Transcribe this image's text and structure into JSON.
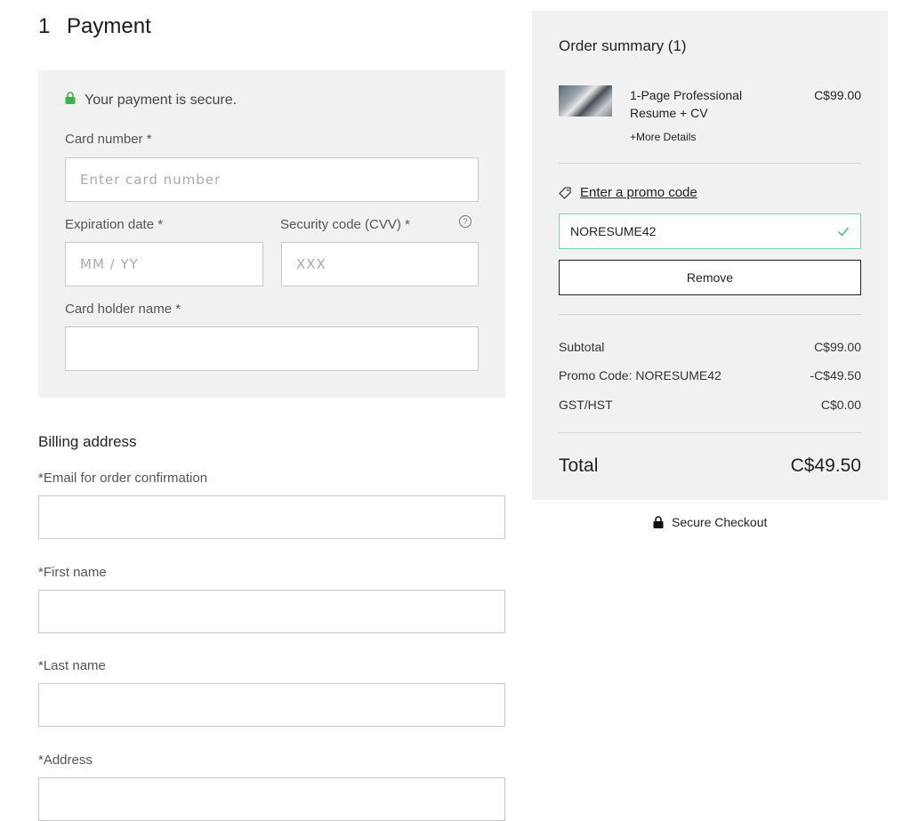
{
  "payment": {
    "step_number": "1",
    "title": "Payment",
    "secure_text": "Your payment is secure.",
    "card_number_label": "Card number *",
    "card_number_placeholder": "Enter card number",
    "expiry_label": "Expiration date *",
    "expiry_placeholder": "MM / YY",
    "cvv_label": "Security code (CVV) *",
    "cvv_placeholder": "XXX",
    "holder_label": "Card holder name *",
    "holder_value": "",
    "icons": {
      "secure": "lock-icon",
      "cvv_help": "info-icon"
    },
    "colors": {
      "lock": "#3bb34a"
    }
  },
  "billing": {
    "title": "Billing address",
    "email_label": "*Email for order confirmation",
    "first_name_label": "*First name",
    "last_name_label": "*Last name",
    "address_label": "*Address"
  },
  "summary": {
    "title": "Order summary (1)",
    "item": {
      "name": "1-Page Professional Resume + CV",
      "price": "C$99.00",
      "more_details": "+More Details"
    },
    "promo_link": "Enter a promo code",
    "promo_value": "NORESUME42",
    "remove_label": "Remove",
    "rows": [
      {
        "label": "Subtotal",
        "value": "C$99.00"
      },
      {
        "label": "Promo Code: NORESUME42",
        "value": "-C$49.50"
      },
      {
        "label": "GST/HST",
        "value": "C$0.00"
      }
    ],
    "total_label": "Total",
    "total_value": "C$49.50",
    "colors": {
      "promo_border": "#7dd3b0",
      "check": "#4caf7d"
    }
  },
  "footer": {
    "secure_checkout": "Secure Checkout"
  }
}
